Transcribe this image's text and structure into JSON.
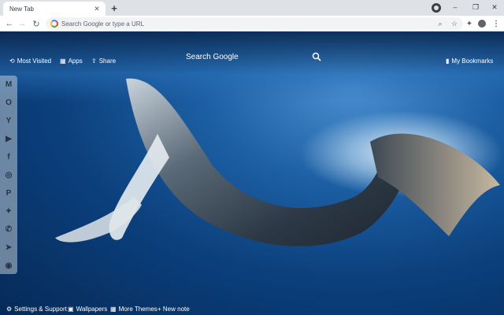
{
  "browser": {
    "tab_title": "New Tab",
    "tab_close": "✕",
    "new_tab": "+",
    "omnibox_placeholder": "Search Google or type a URL",
    "window_controls": {
      "minimize": "–",
      "maximize": "❐",
      "close": "✕"
    },
    "nav": {
      "back": "←",
      "forward": "→",
      "reload": "↻"
    },
    "icons": {
      "zoom": "⌕",
      "star": "☆",
      "extensions": "✦",
      "menu": "⋮"
    }
  },
  "top_links": {
    "most_visited": "Most Visited",
    "apps": "Apps",
    "share": "Share",
    "bookmarks": "My Bookmarks"
  },
  "search": {
    "label": "Search Google"
  },
  "sidebar": {
    "items": [
      {
        "name": "gmail",
        "glyph": "M"
      },
      {
        "name": "outlook",
        "glyph": "O"
      },
      {
        "name": "yahoo",
        "glyph": "Y"
      },
      {
        "name": "youtube",
        "glyph": "▶"
      },
      {
        "name": "facebook",
        "glyph": "f"
      },
      {
        "name": "instagram",
        "glyph": "◎"
      },
      {
        "name": "pinterest",
        "glyph": "P"
      },
      {
        "name": "twitter",
        "glyph": "✦"
      },
      {
        "name": "whatsapp",
        "glyph": "✆"
      },
      {
        "name": "telegram",
        "glyph": "➤"
      },
      {
        "name": "reddit",
        "glyph": "◉"
      }
    ]
  },
  "bottom_links": {
    "settings": "Settings & Support",
    "wallpapers": "Wallpapers",
    "more_themes": "More Themes",
    "new_note": "+ New note"
  },
  "colors": {
    "chrome_bg": "#dee1e6",
    "water": "#0b3f7c",
    "overlay_text": "#ffffff"
  }
}
